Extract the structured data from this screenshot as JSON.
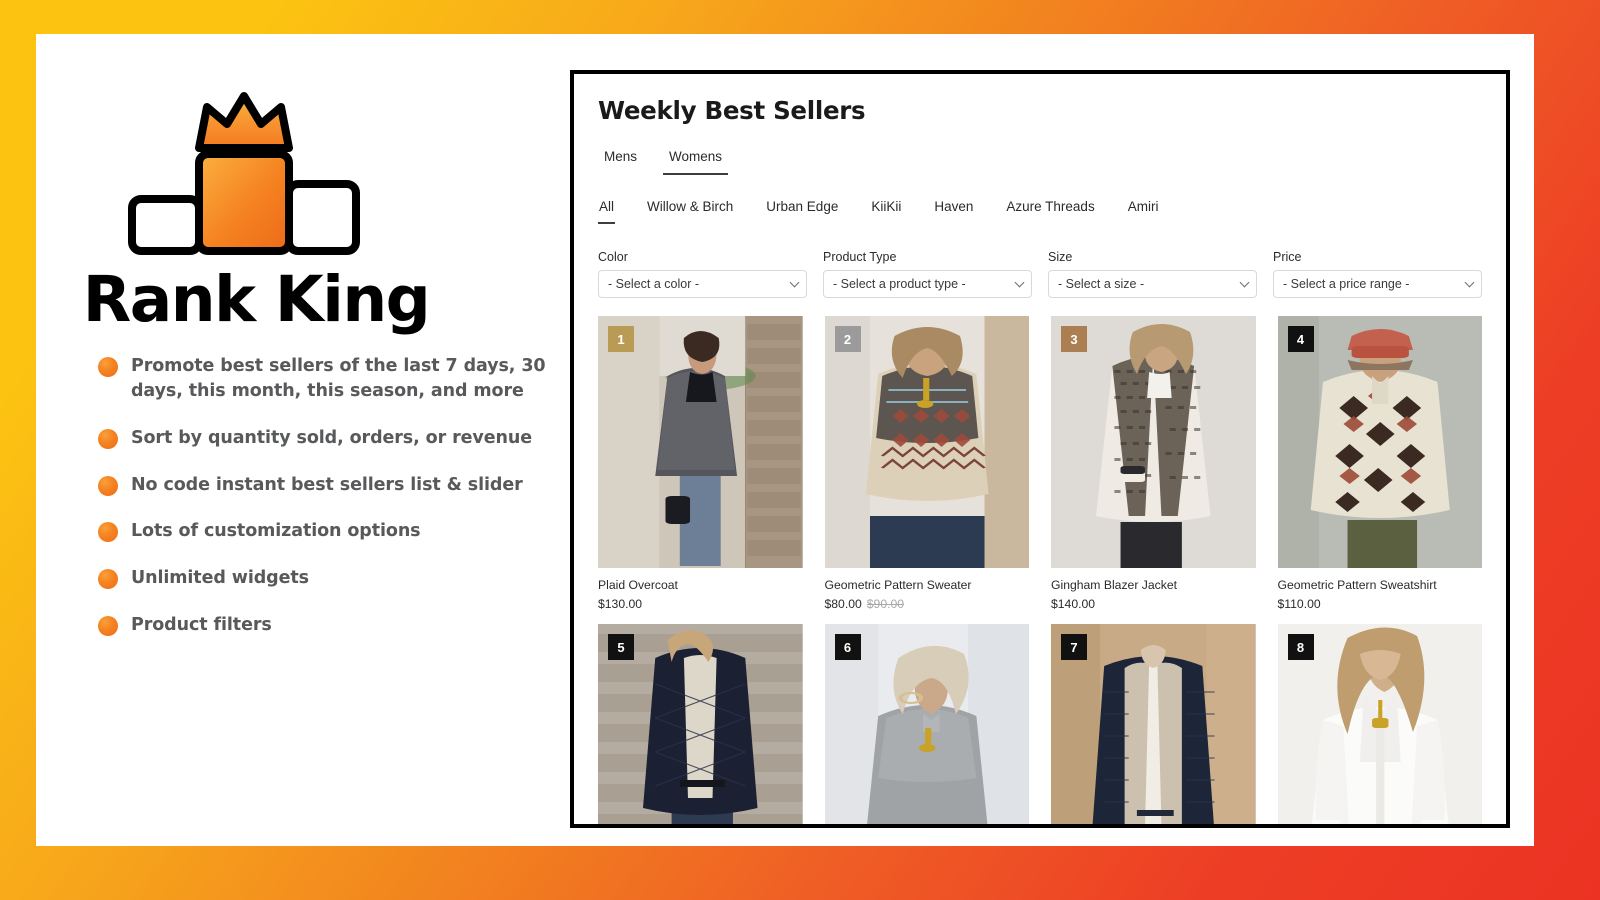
{
  "brand": {
    "name": "Rank King",
    "logo_icon": "podium-crown-icon",
    "accent_orange": "#f58220",
    "accent_yellow": "#fcc411",
    "accent_red": "#ec3323"
  },
  "features": [
    {
      "bullet_icon": "bullet-dot-icon",
      "text": "Promote best sellers of the last 7 days, 30 days, this month, this season, and more"
    },
    {
      "bullet_icon": "bullet-dot-icon",
      "text": "Sort by quantity sold, orders, or revenue"
    },
    {
      "bullet_icon": "bullet-dot-icon",
      "text": "No code instant best sellers list & slider"
    },
    {
      "bullet_icon": "bullet-dot-icon",
      "text": "Lots of customization options"
    },
    {
      "bullet_icon": "bullet-dot-icon",
      "text": "Unlimited widgets"
    },
    {
      "bullet_icon": "bullet-dot-icon",
      "text": "Product filters"
    }
  ],
  "widget": {
    "title": "Weekly Best Sellers",
    "gender_tabs": [
      {
        "label": "Mens",
        "active": false
      },
      {
        "label": "Womens",
        "active": true
      }
    ],
    "brand_tabs": [
      {
        "label": "All",
        "active": true
      },
      {
        "label": "Willow & Birch",
        "active": false
      },
      {
        "label": "Urban Edge",
        "active": false
      },
      {
        "label": "KiiKii",
        "active": false
      },
      {
        "label": "Haven",
        "active": false
      },
      {
        "label": "Azure Threads",
        "active": false
      },
      {
        "label": "Amiri",
        "active": false
      }
    ],
    "filters": [
      {
        "label": "Color",
        "value": "- Select a color -",
        "icon": "chevron-down-icon"
      },
      {
        "label": "Product Type",
        "value": "- Select a product type -",
        "icon": "chevron-down-icon"
      },
      {
        "label": "Size",
        "value": "- Select a size -",
        "icon": "chevron-down-icon"
      },
      {
        "label": "Price",
        "value": "- Select a price range -",
        "icon": "chevron-down-icon"
      }
    ],
    "products": [
      {
        "rank": "1",
        "badge_color": "#b99b55",
        "name": "Plaid Overcoat",
        "price": "$130.00",
        "compare_price": ""
      },
      {
        "rank": "2",
        "badge_color": "#9b9b9b",
        "name": "Geometric Pattern Sweater",
        "price": "$80.00",
        "compare_price": "$90.00"
      },
      {
        "rank": "3",
        "badge_color": "#ab7f51",
        "name": "Gingham Blazer Jacket",
        "price": "$140.00",
        "compare_price": ""
      },
      {
        "rank": "4",
        "badge_color": "#111111",
        "name": "Geometric Pattern Sweatshirt",
        "price": "$110.00",
        "compare_price": ""
      },
      {
        "rank": "5",
        "badge_color": "#111111",
        "name": "",
        "price": "",
        "compare_price": ""
      },
      {
        "rank": "6",
        "badge_color": "#111111",
        "name": "",
        "price": "",
        "compare_price": ""
      },
      {
        "rank": "7",
        "badge_color": "#111111",
        "name": "",
        "price": "",
        "compare_price": ""
      },
      {
        "rank": "8",
        "badge_color": "#111111",
        "name": "",
        "price": "",
        "compare_price": ""
      }
    ]
  }
}
